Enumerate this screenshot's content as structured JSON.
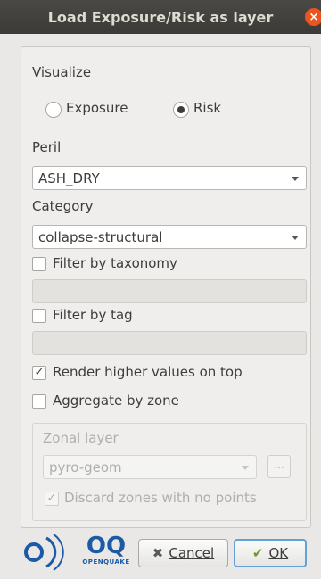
{
  "window": {
    "title": "Load Exposure/Risk as layer",
    "close_glyph": "×"
  },
  "visualize": {
    "label": "Visualize",
    "options": [
      {
        "label": "Exposure",
        "selected": false
      },
      {
        "label": "Risk",
        "selected": true
      }
    ]
  },
  "peril": {
    "label": "Peril",
    "value": "ASH_DRY"
  },
  "category": {
    "label": "Category",
    "value": "collapse-structural"
  },
  "filter_taxonomy": {
    "label": "Filter by taxonomy",
    "checked": false,
    "value": ""
  },
  "filter_tag": {
    "label": "Filter by tag",
    "checked": false,
    "value": ""
  },
  "render_higher": {
    "label": "Render higher values on top",
    "checked": true
  },
  "aggregate": {
    "label": "Aggregate by zone",
    "checked": false
  },
  "zonal": {
    "label": "Zonal layer",
    "value": "pyro-geom",
    "browse_label": "...",
    "discard_label": "Discard zones with no points",
    "discard_checked": true
  },
  "footer": {
    "logo_text": "OQ",
    "logo_subtext": "OPENQUAKE",
    "cancel_label": "Cancel",
    "ok_label": "OK"
  },
  "colors": {
    "titlebar": "#3b3a36",
    "close": "#e95420",
    "ok_border": "#62a0d7"
  }
}
